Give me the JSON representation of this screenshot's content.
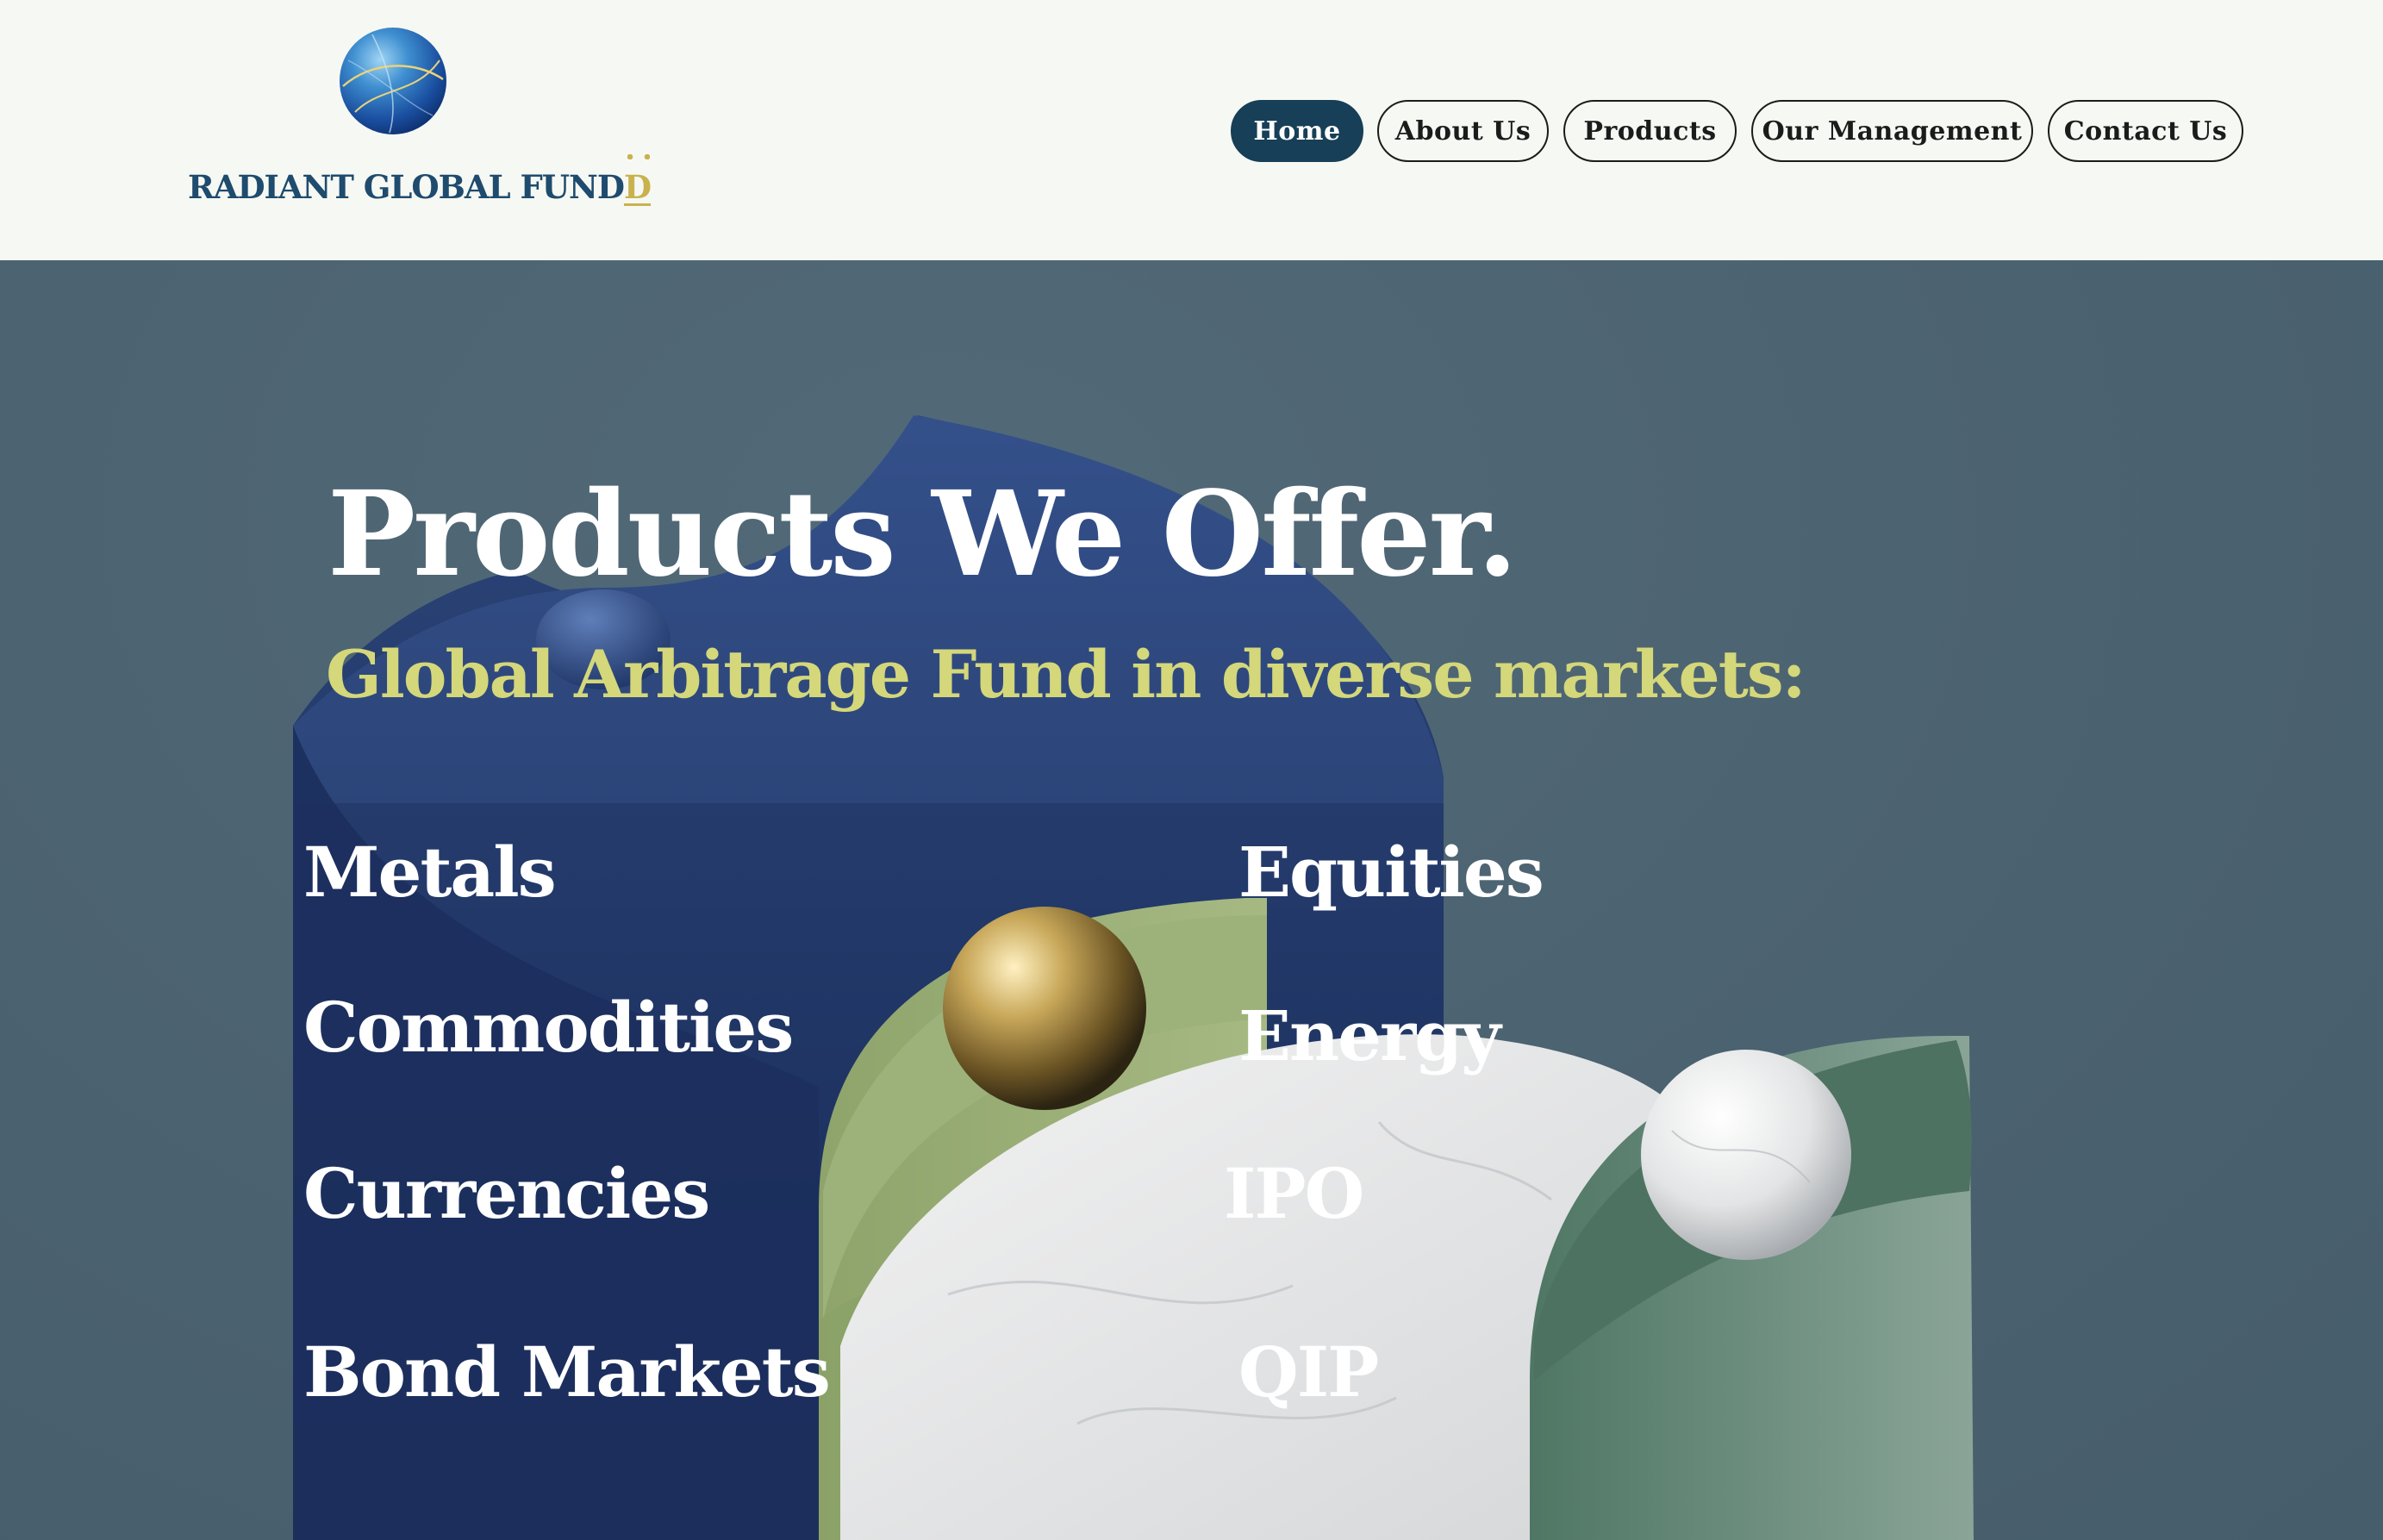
{
  "logo": {
    "text_main": "RADIANT GLOBAL FUND",
    "text_last": "D"
  },
  "nav": {
    "items": [
      {
        "label": "Home",
        "active": true
      },
      {
        "label": "About Us",
        "active": false
      },
      {
        "label": "Products",
        "active": false
      },
      {
        "label": "Our Management",
        "active": false
      },
      {
        "label": "Contact Us",
        "active": false
      }
    ]
  },
  "hero": {
    "title": "Products We Offer.",
    "subtitle": "Global Arbitrage Fund in diverse markets:",
    "products_left": [
      "Metals",
      "Commodities",
      "Currencies",
      "Bond Markets"
    ],
    "products_right": [
      "Equities",
      "Energy",
      "IPO",
      "QIP"
    ]
  },
  "colors": {
    "nav_active": "#173f57",
    "header_bg": "#f6f8f3",
    "hero_bg": "#4b6270",
    "subtitle": "#d4d77a",
    "logo_text": "#1e4b6e",
    "logo_accent": "#c9b24e"
  },
  "icons": {
    "logo": "globe-icon"
  }
}
